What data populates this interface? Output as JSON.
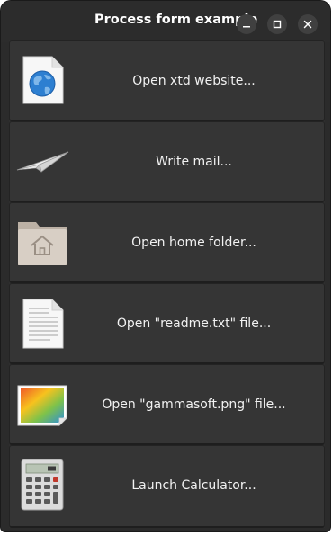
{
  "window": {
    "title": "Process form example"
  },
  "buttons": [
    {
      "label": "Open xtd website...",
      "icon": "globe-document-icon"
    },
    {
      "label": "Write mail...",
      "icon": "paper-plane-icon"
    },
    {
      "label": "Open home folder...",
      "icon": "home-folder-icon"
    },
    {
      "label": "Open \"readme.txt\" file...",
      "icon": "text-document-icon"
    },
    {
      "label": "Open \"gammasoft.png\" file...",
      "icon": "image-file-icon"
    },
    {
      "label": "Launch Calculator...",
      "icon": "calculator-icon"
    }
  ]
}
